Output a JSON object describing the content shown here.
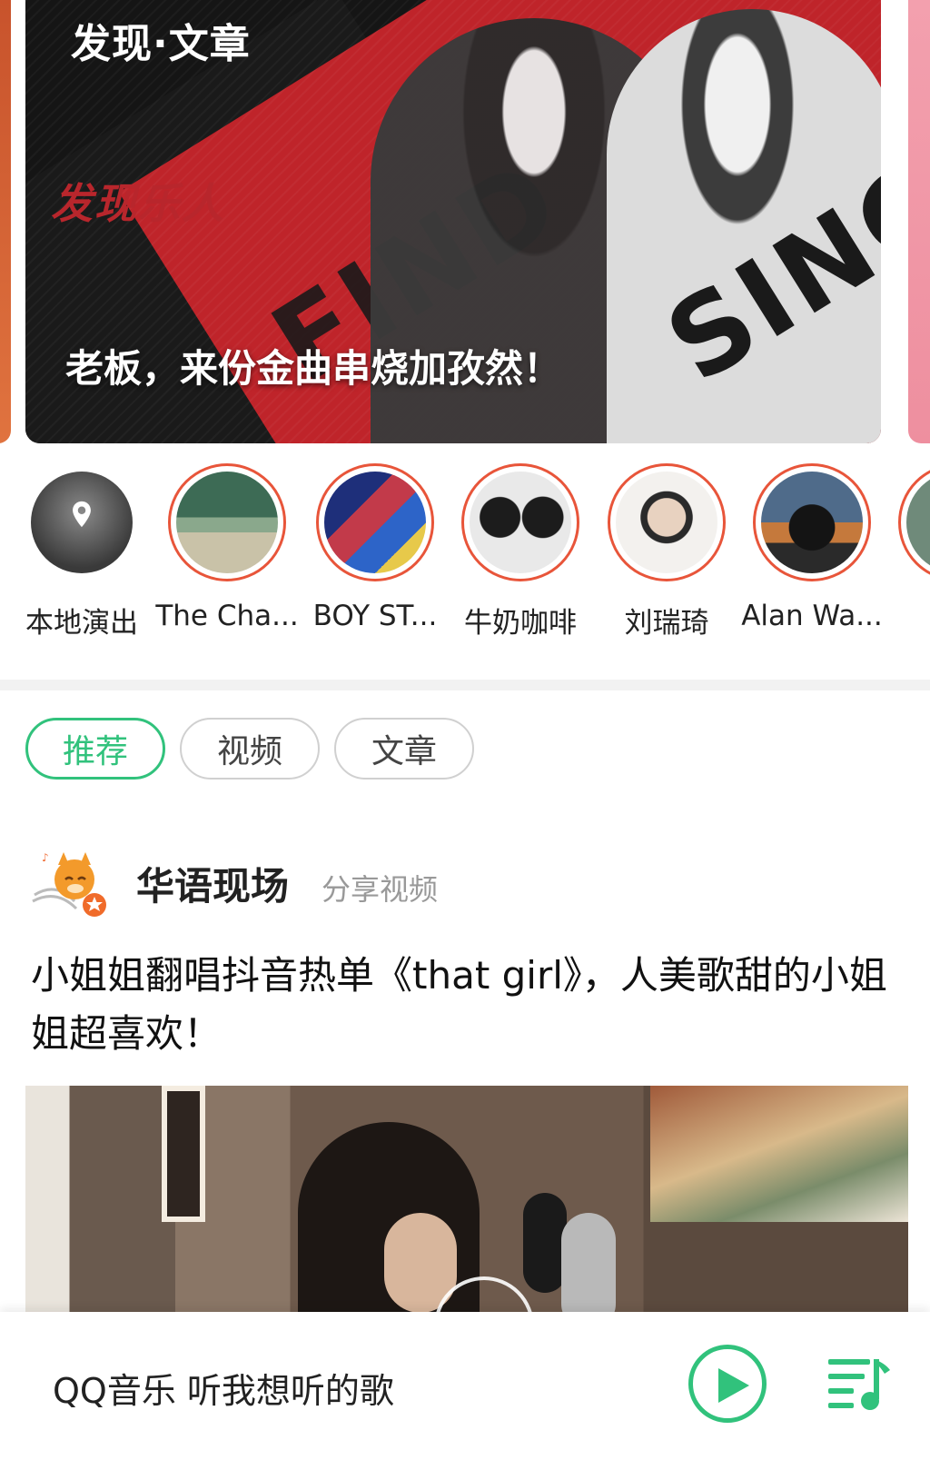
{
  "banner": {
    "tag": "发现·文章",
    "subtitle": "发现乐人",
    "caption": "老板，来份金曲串烧加孜然！",
    "art_words": [
      "FIND",
      "SINGER"
    ]
  },
  "artists": [
    {
      "name": "本地演出",
      "icon": "location-pin-icon",
      "ring": false
    },
    {
      "name": "The Cha...",
      "ring": true
    },
    {
      "name": "BOY ST...",
      "ring": true
    },
    {
      "name": "牛奶咖啡",
      "ring": true
    },
    {
      "name": "刘瑞琦",
      "ring": true
    },
    {
      "name": "Alan Wa...",
      "ring": true
    }
  ],
  "tabs": [
    {
      "label": "推荐",
      "active": true
    },
    {
      "label": "视频",
      "active": false
    },
    {
      "label": "文章",
      "active": false
    }
  ],
  "post": {
    "author": "华语现场",
    "action": "分享视频",
    "title": "小姐姐翻唱抖音热单《that girl》，人美歌甜的小姐姐超喜欢！"
  },
  "player": {
    "song": "QQ音乐 听我想听的歌",
    "play_icon": "play-icon",
    "playlist_icon": "playlist-icon"
  },
  "colors": {
    "accent": "#31c27c",
    "ring": "#e8553a",
    "banner_red": "#c8252b"
  }
}
